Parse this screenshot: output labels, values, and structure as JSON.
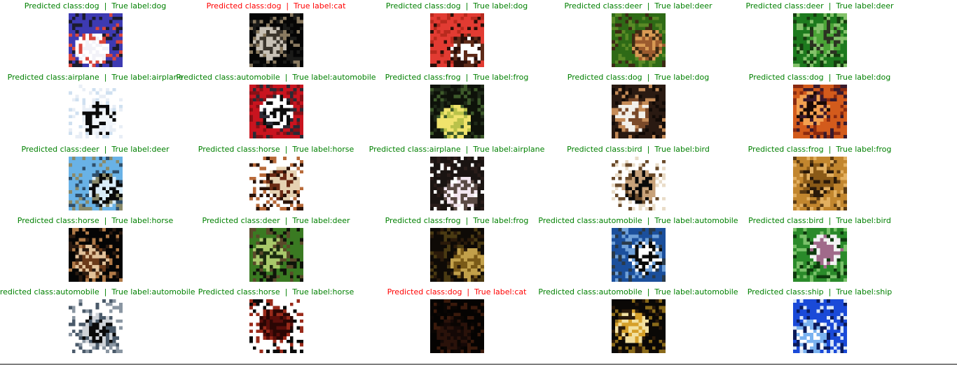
{
  "panels": [
    {
      "predicted": "dog",
      "true_label": "dog",
      "correct": true,
      "color": "#008000",
      "thumbnail": {
        "subject": "white dog",
        "palette": [
          "#3d3ab2",
          "#f2f2f8",
          "#ffffff",
          "#d9463c",
          "#1c1c2e"
        ]
      }
    },
    {
      "predicted": "dog",
      "true_label": "cat",
      "correct": false,
      "color": "#ff0000",
      "thumbnail": {
        "subject": "dark cat",
        "palette": [
          "#050505",
          "#3a342c",
          "#c7c0b5",
          "#8a7a60",
          "#1a1a18"
        ]
      }
    },
    {
      "predicted": "dog",
      "true_label": "dog",
      "correct": true,
      "color": "#008000",
      "thumbnail": {
        "subject": "red dog face",
        "palette": [
          "#e23b32",
          "#ffffff",
          "#5e2a18",
          "#2a0e08",
          "#b82a1e"
        ]
      }
    },
    {
      "predicted": "deer",
      "true_label": "deer",
      "correct": true,
      "color": "#008000",
      "thumbnail": {
        "subject": "deer head",
        "palette": [
          "#2e6a16",
          "#9b5b2e",
          "#d89a54",
          "#3c2a14",
          "#5a8a26"
        ]
      }
    },
    {
      "predicted": "deer",
      "true_label": "deer",
      "correct": true,
      "color": "#008000",
      "thumbnail": {
        "subject": "deer in grass",
        "palette": [
          "#1d7a1e",
          "#4aa436",
          "#2c3222",
          "#83c26a",
          "#153c0f"
        ]
      }
    },
    {
      "predicted": "airplane",
      "true_label": "airplane",
      "correct": true,
      "color": "#008000",
      "thumbnail": {
        "subject": "black airplane on white sky",
        "palette": [
          "#ffffff",
          "#f2f6fb",
          "#0a0a0a",
          "#e8eef6",
          "#cfe0f0"
        ]
      }
    },
    {
      "predicted": "automobile",
      "true_label": "automobile",
      "correct": true,
      "color": "#008000",
      "thumbnail": {
        "subject": "red car",
        "palette": [
          "#c9141f",
          "#0d0d0d",
          "#ffffff",
          "#2a2a35",
          "#8a1016"
        ]
      }
    },
    {
      "predicted": "frog",
      "true_label": "frog",
      "correct": true,
      "color": "#008000",
      "thumbnail": {
        "subject": "frog",
        "palette": [
          "#0e120a",
          "#b9c24a",
          "#f0e36c",
          "#3d5a2a",
          "#1f2a18"
        ]
      }
    },
    {
      "predicted": "dog",
      "true_label": "dog",
      "correct": true,
      "color": "#008000",
      "thumbnail": {
        "subject": "brown dog",
        "palette": [
          "#2a1a12",
          "#7a4a2a",
          "#f2f0ea",
          "#c48a56",
          "#120a06"
        ]
      }
    },
    {
      "predicted": "dog",
      "true_label": "dog",
      "correct": true,
      "color": "#008000",
      "thumbnail": {
        "subject": "orange long-haired dog",
        "palette": [
          "#d35b1c",
          "#1b0a06",
          "#f3a050",
          "#3a1a2c",
          "#8a2a10"
        ]
      }
    },
    {
      "predicted": "deer",
      "true_label": "deer",
      "correct": true,
      "color": "#008000",
      "thumbnail": {
        "subject": "deer on hill",
        "palette": [
          "#69b2e6",
          "#d8ecf8",
          "#0a0a0a",
          "#8a8a6a",
          "#2f4f6a"
        ]
      }
    },
    {
      "predicted": "horse",
      "true_label": "horse",
      "correct": true,
      "color": "#008000",
      "thumbnail": {
        "subject": "brown horse",
        "palette": [
          "#ffffff",
          "#6b2a14",
          "#e6d2b2",
          "#2a1208",
          "#b86a3a"
        ]
      }
    },
    {
      "predicted": "airplane",
      "true_label": "airplane",
      "correct": true,
      "color": "#008000",
      "thumbnail": {
        "subject": "dark bird shape",
        "palette": [
          "#1a1412",
          "#f3e6f0",
          "#5a4a44",
          "#ffffff",
          "#2a1d1a"
        ]
      }
    },
    {
      "predicted": "bird",
      "true_label": "bird",
      "correct": true,
      "color": "#008000",
      "thumbnail": {
        "subject": "bird on branch",
        "palette": [
          "#ffffff",
          "#0a0a0a",
          "#c8a27a",
          "#6a4a2a",
          "#e9dcc8"
        ]
      }
    },
    {
      "predicted": "frog",
      "true_label": "frog",
      "correct": true,
      "color": "#008000",
      "thumbnail": {
        "subject": "frog on sand",
        "palette": [
          "#c2862e",
          "#8a5a18",
          "#2a1a0a",
          "#e3b060",
          "#5a3a12"
        ]
      }
    },
    {
      "predicted": "horse",
      "true_label": "horse",
      "correct": true,
      "color": "#008000",
      "thumbnail": {
        "subject": "rider on horse",
        "palette": [
          "#050505",
          "#6a3a1a",
          "#e2c29a",
          "#2a1a10",
          "#b07a48"
        ]
      }
    },
    {
      "predicted": "deer",
      "true_label": "deer",
      "correct": true,
      "color": "#008000",
      "thumbnail": {
        "subject": "deer in forest",
        "palette": [
          "#3a7a22",
          "#1a2a10",
          "#a8c86a",
          "#5a4a2a",
          "#0f140a"
        ]
      }
    },
    {
      "predicted": "frog",
      "true_label": "frog",
      "correct": true,
      "color": "#008000",
      "thumbnail": {
        "subject": "dark frog",
        "palette": [
          "#0e0a06",
          "#7a5a18",
          "#c2a04a",
          "#2a1a0a",
          "#4a3a12"
        ]
      }
    },
    {
      "predicted": "automobile",
      "true_label": "automobile",
      "correct": true,
      "color": "#008000",
      "thumbnail": {
        "subject": "blue car",
        "palette": [
          "#1b4f9c",
          "#ffffff",
          "#0a0a0a",
          "#6fa0d8",
          "#2a3a4a"
        ]
      }
    },
    {
      "predicted": "bird",
      "true_label": "bird",
      "correct": true,
      "color": "#008000",
      "thumbnail": {
        "subject": "bird in grass",
        "palette": [
          "#2a8a2a",
          "#a06a8a",
          "#f2f2f2",
          "#0d3a0d",
          "#7ac26a"
        ]
      }
    },
    {
      "predicted": "automobile",
      "true_label": "automobile",
      "correct": true,
      "color": "#008000",
      "thumbnail": {
        "subject": "white car on white",
        "palette": [
          "#ffffff",
          "#0a0a0a",
          "#cfd3d8",
          "#4a5a6a",
          "#8a96a2"
        ]
      }
    },
    {
      "predicted": "horse",
      "true_label": "horse",
      "correct": true,
      "color": "#008000",
      "thumbnail": {
        "subject": "dark red animal",
        "palette": [
          "#ffffff",
          "#5a0e0a",
          "#2a0604",
          "#9a2a1a",
          "#0a0a0a"
        ]
      }
    },
    {
      "predicted": "dog",
      "true_label": "cat",
      "correct": false,
      "color": "#ff0000",
      "thumbnail": {
        "subject": "very dark cat",
        "palette": [
          "#050302",
          "#140806",
          "#2a120a",
          "#0a0503",
          "#3a1a0c"
        ]
      }
    },
    {
      "predicted": "automobile",
      "true_label": "automobile",
      "correct": true,
      "color": "#008000",
      "thumbnail": {
        "subject": "car in showroom",
        "palette": [
          "#0a0806",
          "#d6a02a",
          "#f2e0a0",
          "#2a1a0a",
          "#8a6a1a"
        ]
      }
    },
    {
      "predicted": "ship",
      "true_label": "ship",
      "correct": true,
      "color": "#008000",
      "thumbnail": {
        "subject": "white ship on blue water",
        "palette": [
          "#1a4ad8",
          "#ffffff",
          "#7ab2f0",
          "#0a1a5a",
          "#d8e6f8"
        ]
      }
    }
  ],
  "caption_parts": {
    "predicted_prefix": "Predicted class:",
    "separator": "  |  ",
    "true_prefix": "True label:"
  }
}
